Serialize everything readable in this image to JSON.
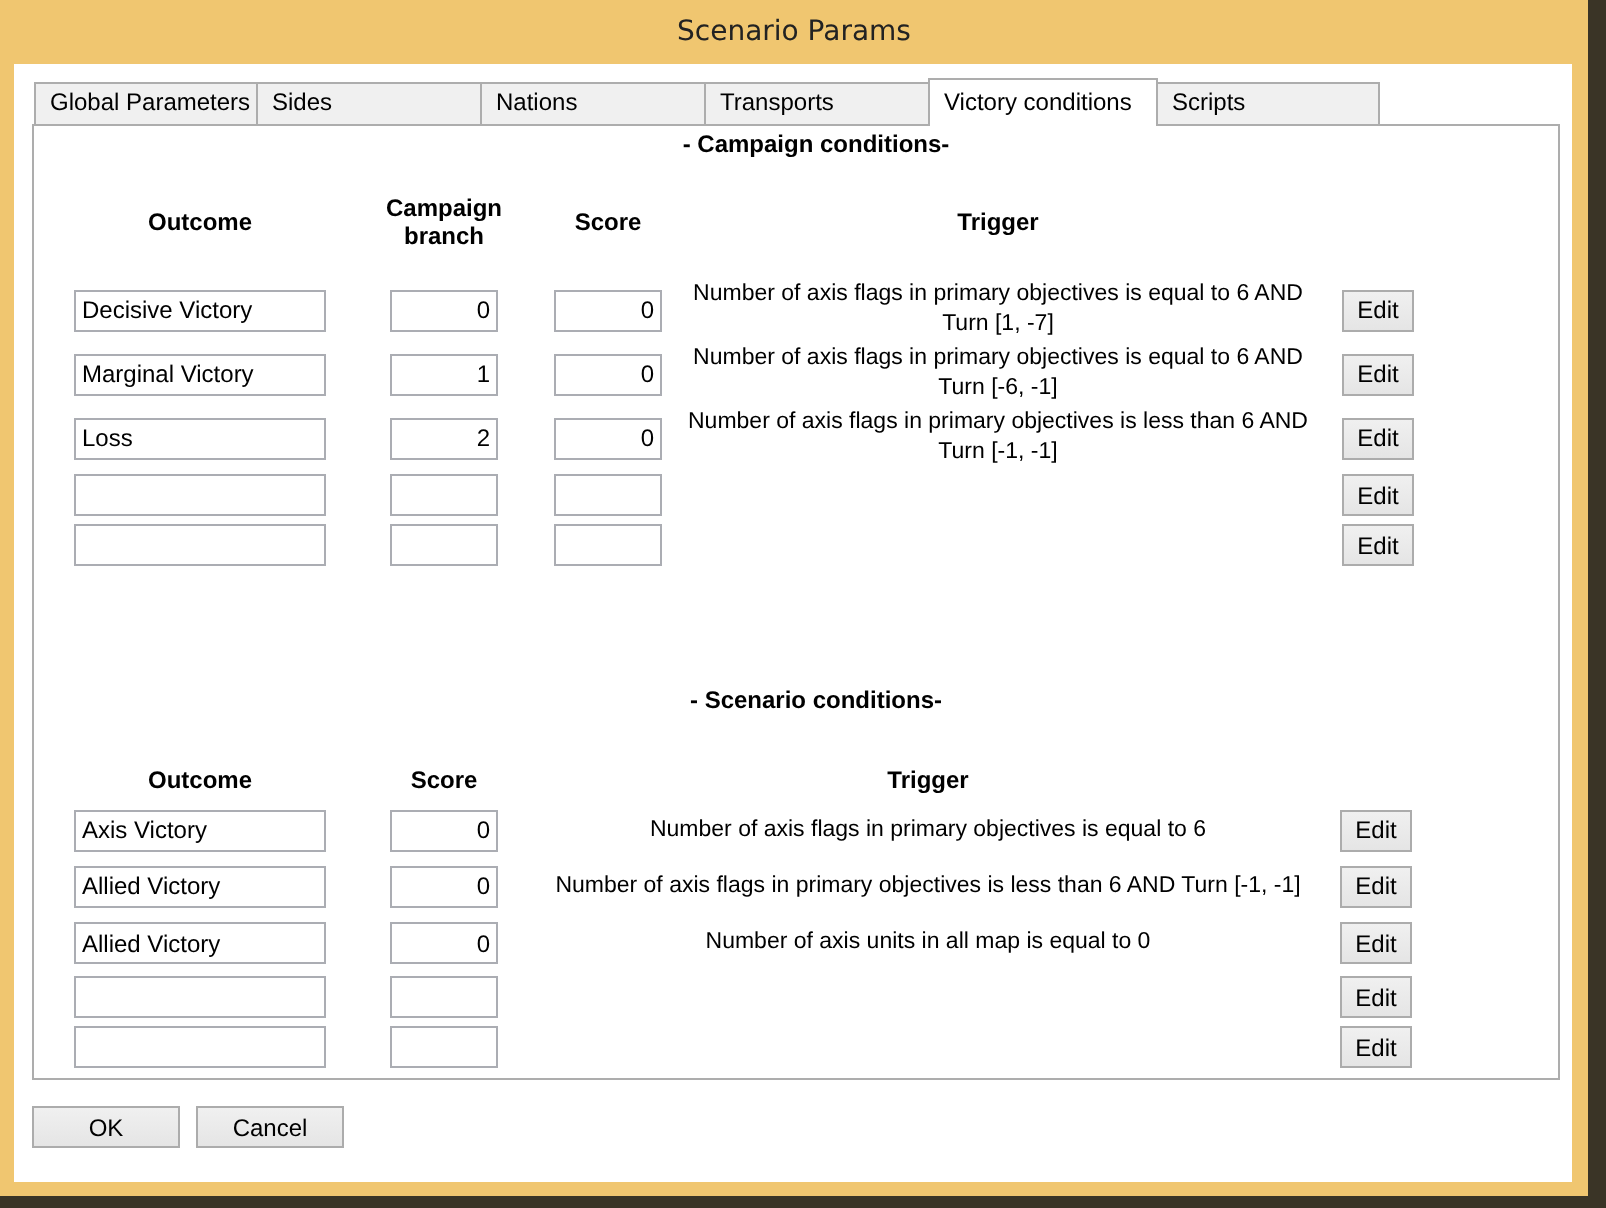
{
  "window": {
    "title": "Scenario Params"
  },
  "tabs": [
    {
      "label": "Global Parameters",
      "selected": false
    },
    {
      "label": "Sides",
      "selected": false
    },
    {
      "label": "Nations",
      "selected": false
    },
    {
      "label": "Transports",
      "selected": false
    },
    {
      "label": "Victory conditions",
      "selected": true
    },
    {
      "label": "Scripts",
      "selected": false
    }
  ],
  "campaign_conditions": {
    "heading": "- Campaign conditions-",
    "columns": [
      "Outcome",
      "Campaign branch",
      "Score",
      "Trigger"
    ],
    "rows": [
      {
        "outcome": "Decisive Victory",
        "campaign_branch": "0",
        "score": "0",
        "trigger": "Number of axis flags in primary objectives is equal to 6 AND Turn [1, -7]",
        "edit_button": "Edit"
      },
      {
        "outcome": "Marginal Victory",
        "campaign_branch": "1",
        "score": "0",
        "trigger": "Number of axis flags in primary objectives is equal to 6 AND Turn [-6, -1]",
        "edit_button": "Edit"
      },
      {
        "outcome": "Loss",
        "campaign_branch": "2",
        "score": "0",
        "trigger": "Number of axis flags in primary objectives is less than 6 AND Turn [-1, -1]",
        "edit_button": "Edit"
      },
      {
        "edit_button": "Edit"
      },
      {
        "edit_button": "Edit"
      }
    ]
  },
  "scenario_conditions": {
    "heading": "- Scenario conditions-",
    "columns": [
      "Outcome",
      "Score",
      "Trigger"
    ],
    "rows": [
      {
        "outcome": "Axis Victory",
        "score": "0",
        "trigger": "Number of axis flags in primary objectives is equal to 6",
        "edit_button": "Edit"
      },
      {
        "outcome": "Allied Victory",
        "score": "0",
        "trigger": "Number of axis flags in primary objectives is less than 6 AND Turn [-1, -1]",
        "edit_button": "Edit"
      },
      {
        "outcome": "Allied Victory",
        "score": "0",
        "trigger": "Number of axis units in all map is equal to 0",
        "edit_button": "Edit"
      },
      {
        "edit_button": "Edit"
      },
      {
        "edit_button": "Edit"
      }
    ]
  },
  "buttons": [
    "OK",
    "Cancel"
  ]
}
